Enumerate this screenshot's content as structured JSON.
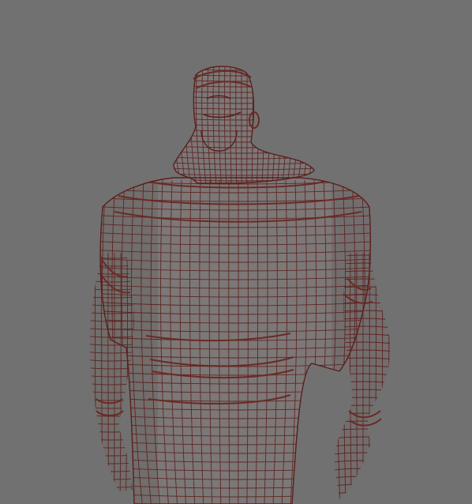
{
  "viewport": {
    "background": "#717171",
    "mesh_fill": "#7c7877",
    "mesh_shade": "#5f5b5a",
    "wire_color": "#5a1f1c",
    "accessory_color": "#6b2a24"
  },
  "subject": {
    "icon": "character-wireframe-icon"
  }
}
